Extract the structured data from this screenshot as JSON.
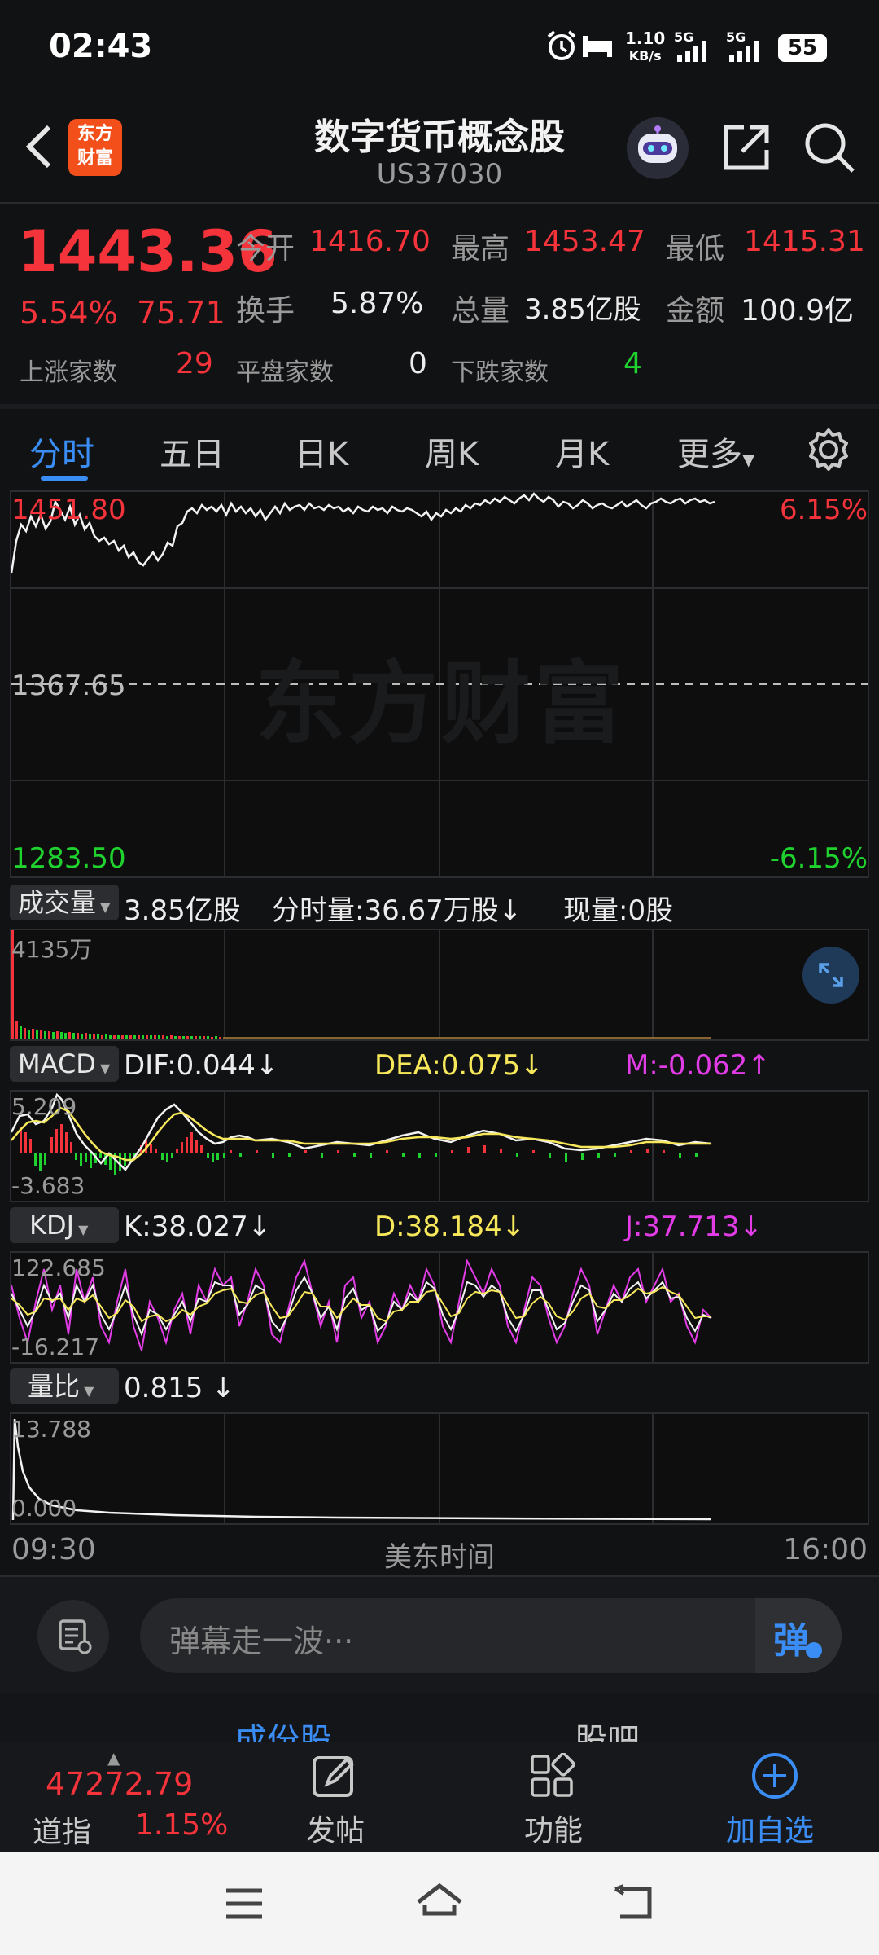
{
  "status": {
    "time": "02:43",
    "net_speed_top": "1.10",
    "net_speed_unit": "KB/s",
    "sig1": "5G",
    "sig2": "5G",
    "battery": "55"
  },
  "header": {
    "title": "数字货币概念股",
    "code": "US37030",
    "back_icon": "chevron-left-icon",
    "logo_text": "东方财富"
  },
  "quote": {
    "price": "1443.36",
    "change_pct": "5.54%",
    "change": "75.71",
    "open_label": "今开",
    "open": "1416.70",
    "high_label": "最高",
    "high": "1453.47",
    "low_label": "最低",
    "low": "1415.31",
    "turnover_label": "换手",
    "turnover": "5.87%",
    "volume_label": "总量",
    "volume": "3.85亿股",
    "amount_label": "金额",
    "amount": "100.9亿",
    "up_label": "上涨家数",
    "up": "29",
    "flat_label": "平盘家数",
    "flat": "0",
    "down_label": "下跌家数",
    "down": "4"
  },
  "tabs": {
    "t1": "分时",
    "t2": "五日",
    "t3": "日K",
    "t4": "周K",
    "t5": "月K",
    "t6": "更多"
  },
  "chart": {
    "high_price": "1451.80",
    "high_pct": "6.15%",
    "mid_price": "1367.65",
    "low_price": "1283.50",
    "low_pct": "-6.15%",
    "watermark": "东方财富"
  },
  "volume": {
    "selector": "成交量",
    "total": "3.85亿股",
    "tick": "分时量:36.67万股",
    "tick_arrow": "↓",
    "current": "现量:0股",
    "max_label": "4135万"
  },
  "macd": {
    "selector": "MACD",
    "dif": "DIF:0.044",
    "dif_arrow": "↓",
    "dea": "DEA:0.075",
    "dea_arrow": "↓",
    "m": "M:-0.062",
    "m_arrow": "↑",
    "top": "5.209",
    "bottom": "-3.683"
  },
  "kdj": {
    "selector": "KDJ",
    "k": "K:38.027",
    "k_arrow": "↓",
    "d": "D:38.184",
    "d_arrow": "↓",
    "j": "J:37.713",
    "j_arrow": "↓",
    "top": "122.685",
    "bottom": "-16.217"
  },
  "ratio": {
    "selector": "量比",
    "value": "0.815",
    "arrow": "↓",
    "top": "13.788",
    "bottom": "0.000"
  },
  "time_axis": {
    "start": "09:30",
    "mid": "美东时间",
    "end": "16:00"
  },
  "comment": {
    "placeholder": "弹幕走一波···",
    "danmu_btn": "弹"
  },
  "section_tabs": {
    "left": "成份股",
    "right": "股吧"
  },
  "bottom_nav": {
    "index_value": "47272.79",
    "index_name": "道指",
    "index_pct": "1.15%",
    "post": "发帖",
    "func": "功能",
    "add": "加自选"
  },
  "colors": {
    "up": "#f5333b",
    "down": "#1fd22e",
    "accent": "#3a8df5",
    "yellow": "#f6e85a",
    "magenta": "#e23ce6"
  }
}
